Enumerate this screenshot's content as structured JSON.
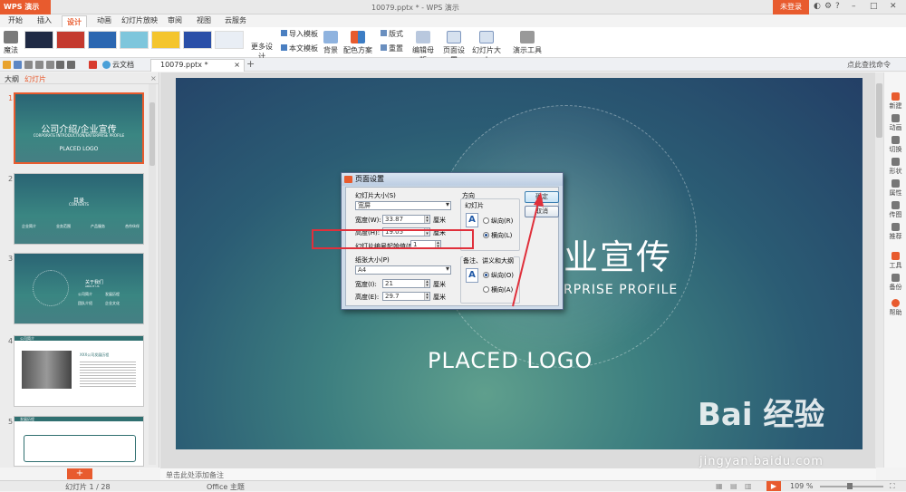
{
  "app": {
    "name": "WPS 演示",
    "doc_title": "10079.pptx * - WPS 演示",
    "login": "未登录"
  },
  "menu": [
    "开始",
    "插入",
    "设计",
    "动画",
    "幻灯片放映",
    "审阅",
    "视图",
    "云服务"
  ],
  "menu_active": "设计",
  "ribbon": {
    "magic": "魔法",
    "more_design": "更多设计",
    "import_template": "导入模板",
    "text_template": "本文模板",
    "background": "背景",
    "color_scheme": "配色方案",
    "layout": "版式",
    "reset": "重置",
    "edit_master": "编辑母版",
    "page_setup": "页面设置",
    "slide_size": "幻灯片大小",
    "presentation_tools": "演示工具"
  },
  "tabs": {
    "cloud_doc": "云文档",
    "doc_tab": "10079.pptx *",
    "search_cmd": "点此查找命令"
  },
  "panel": {
    "tab_outline": "大纲",
    "tab_slides": "幻灯片",
    "slide_numbers": [
      "1",
      "2",
      "3",
      "4",
      "5"
    ],
    "slides": [
      {
        "title": "公司介绍/企业宣传",
        "sub": "CORPORATE INTRODUCTION/ENTERPRISE PROFILE",
        "logo": "PLACED LOGO"
      },
      {
        "title": "目录",
        "sub": "CONTENTS",
        "items": [
          "企业简介",
          "业务范围",
          "产品服务",
          "合作伙伴"
        ]
      },
      {
        "title": "关于我们",
        "sub": "ABOUT US",
        "items": [
          "公司简介",
          "发展历程",
          "团队介绍",
          "企业文化"
        ]
      },
      {
        "header": "公司简介",
        "title": "XXX公司发展历程"
      },
      {
        "header": "发展历程"
      }
    ]
  },
  "main_slide": {
    "title_fragment": "业宣传",
    "subtitle_fragment": "RPRISE PROFILE",
    "logo": "PLACED LOGO"
  },
  "right_bar": [
    "新建",
    "动画",
    "切换",
    "形状",
    "属性",
    "传图",
    "推荐",
    "工具",
    "备份",
    "帮助"
  ],
  "notes_placeholder": "单击此处添加备注",
  "status": {
    "slide_pos": "幻灯片 1 / 28",
    "theme": "Office 主题",
    "zoom": "109 %"
  },
  "dialog": {
    "title": "页面设置",
    "slide_size_label": "幻灯片大小(S)",
    "slide_size_value": "宽屏",
    "width_label": "宽度(W):",
    "width_value": "33.87",
    "height_label": "高度(H):",
    "height_value": "19.05",
    "unit": "厘米",
    "start_num_label": "幻灯片编号起始值(N):",
    "start_num_value": "1",
    "paper_label": "纸张大小(P)",
    "paper_value": "A4",
    "paper_width_label": "宽度(I):",
    "paper_width_value": "21",
    "paper_height_label": "高度(E):",
    "paper_height_value": "29.7",
    "orientation_label": "方向",
    "slides_label": "幻灯片",
    "portrait": "纵向(R)",
    "landscape": "横向(L)",
    "notes_label": "备注、讲义和大纲",
    "notes_portrait": "纵向(O)",
    "notes_landscape": "横向(A)",
    "ok": "确定",
    "cancel": "取消"
  },
  "watermark": {
    "brand": "Bai 经验",
    "url": "jingyan.baidu.com"
  },
  "colors": {
    "accent": "#e85b2e",
    "highlight": "#e0303b"
  }
}
